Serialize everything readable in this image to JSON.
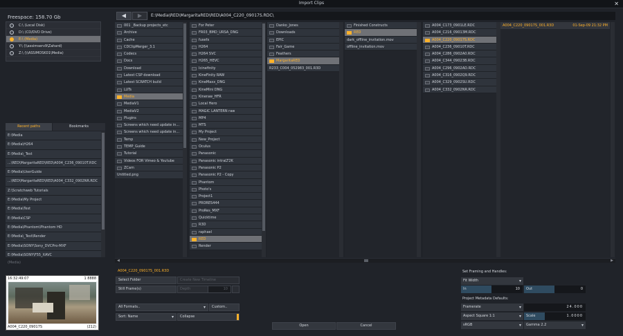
{
  "window": {
    "title": "Import Clips",
    "close_glyph": "✕"
  },
  "freespace": "Freespace: 158.70 Gb",
  "drives": [
    {
      "label": "C:\\ (Local Disk)",
      "selected": false
    },
    {
      "label": "D:\\ (CD/DVD Drive)",
      "selected": false
    },
    {
      "label": "E:\\ (Media)",
      "selected": true
    },
    {
      "label": "Y:\\ (\\\\assimserv9\\Zahard)",
      "selected": false
    },
    {
      "label": "Z:\\ (\\\\ASSIMOSK01\\Media)",
      "selected": false
    }
  ],
  "tabs": {
    "recent": "Recent paths",
    "bookmarks": "Bookmarks"
  },
  "recent_paths": [
    "E:\\Media",
    "E:\\Media\\H264",
    "E:\\Media\\_Test",
    "...\\RED\\MargaritaRED\\RED\\A004_C236_09010T.RDC",
    "E:\\Media\\UserGuide",
    "...\\RED\\MargaritaRED\\RED\\A004_C332_0902NR.RDC",
    "Z:\\Scratchweb Tutorials",
    "E:\\Media\\My Project",
    "E:\\Media\\Test",
    "E:\\Media\\CSP",
    "E:\\Media\\Phantom\\Phantom HD",
    "E:\\Media\\_Test\\Render",
    "E:\\Media\\SONY\\Sony_DVCPro-MXF",
    "E:\\Media\\SONY\\F55_XAVC"
  ],
  "media_label": "(Media)",
  "thumbnail": {
    "timecode": "16:32:49:07",
    "frames": "1 8888",
    "clip": "A004_C220_09017S",
    "count": "(212)"
  },
  "nav": {
    "back": "◀",
    "forward": "▶",
    "path": "E:\\Media\\RED\\MargaritaRED\\RED\\A004_C220_09017S.RDC\\"
  },
  "columns": [
    {
      "items": [
        {
          "label": "001 _Backup projects_etc",
          "type": "folder",
          "sel": false
        },
        {
          "label": "Archive",
          "type": "folder",
          "sel": false
        },
        {
          "label": "Cache",
          "type": "folder",
          "sel": false
        },
        {
          "label": "CDClipMerger_3.1",
          "type": "folder",
          "sel": false
        },
        {
          "label": "Codecs",
          "type": "folder",
          "sel": false
        },
        {
          "label": "Docs",
          "type": "folder",
          "sel": false
        },
        {
          "label": "Download",
          "type": "folder",
          "sel": false
        },
        {
          "label": "Latest CSP download",
          "type": "folder",
          "sel": false
        },
        {
          "label": "Latest SCRATCH build",
          "type": "folder",
          "sel": false
        },
        {
          "label": "LUTs",
          "type": "folder",
          "sel": false
        },
        {
          "label": "Media",
          "type": "folder",
          "sel": true
        },
        {
          "label": "MediaV1",
          "type": "folder",
          "sel": false
        },
        {
          "label": "MediaV2",
          "type": "folder",
          "sel": false
        },
        {
          "label": "Plugins",
          "type": "folder",
          "sel": false
        },
        {
          "label": "Screens which need update in...",
          "type": "folder",
          "sel": false
        },
        {
          "label": "Screens which need update in...",
          "type": "folder",
          "sel": false
        },
        {
          "label": "Temp",
          "type": "folder",
          "sel": false
        },
        {
          "label": "TEMP_Guide",
          "type": "folder",
          "sel": false
        },
        {
          "label": "Tutorial",
          "type": "folder",
          "sel": false
        },
        {
          "label": "Videos FOR Vimeo & Youtube",
          "type": "folder",
          "sel": false
        },
        {
          "label": "ZCam",
          "type": "folder",
          "sel": false
        },
        {
          "label": "Untitled.png",
          "type": "file",
          "sel": false
        }
      ]
    },
    {
      "items": [
        {
          "label": "For Peter",
          "type": "folder",
          "sel": false
        },
        {
          "label": "FR03_BMD_URSA_DNG",
          "type": "folder",
          "sel": false
        },
        {
          "label": "fusefx",
          "type": "folder",
          "sel": false
        },
        {
          "label": "H264",
          "type": "folder",
          "sel": false
        },
        {
          "label": "H264 SVC",
          "type": "folder",
          "sel": false
        },
        {
          "label": "H265_HEVC",
          "type": "folder",
          "sel": false
        },
        {
          "label": "Icinefinity",
          "type": "folder",
          "sel": false
        },
        {
          "label": "KineFinity RAW",
          "type": "folder",
          "sel": false
        },
        {
          "label": "KineMaxx_DNG",
          "type": "folder",
          "sel": false
        },
        {
          "label": "KineMini DNG",
          "type": "folder",
          "sel": false
        },
        {
          "label": "Kineraw_HFR",
          "type": "folder",
          "sel": false
        },
        {
          "label": "Local Hero",
          "type": "folder",
          "sel": false
        },
        {
          "label": "MAGIC LANTERN raw",
          "type": "folder",
          "sel": false
        },
        {
          "label": "MP4",
          "type": "folder",
          "sel": false
        },
        {
          "label": "MTS",
          "type": "folder",
          "sel": false
        },
        {
          "label": "My Project",
          "type": "folder",
          "sel": false
        },
        {
          "label": "New_Project",
          "type": "folder",
          "sel": false
        },
        {
          "label": "Oculus",
          "type": "folder",
          "sel": false
        },
        {
          "label": "Panasonic",
          "type": "folder",
          "sel": false
        },
        {
          "label": "Panasonic intraLT2K",
          "type": "folder",
          "sel": false
        },
        {
          "label": "Panasonic P2",
          "type": "folder",
          "sel": false
        },
        {
          "label": "Panasonic P2 - Copy",
          "type": "folder",
          "sel": false
        },
        {
          "label": "Phantom",
          "type": "folder",
          "sel": false
        },
        {
          "label": "Photo's",
          "type": "folder",
          "sel": false
        },
        {
          "label": "Project1",
          "type": "folder",
          "sel": false
        },
        {
          "label": "PRORES444",
          "type": "folder",
          "sel": false
        },
        {
          "label": "ProRes_MXF",
          "type": "folder",
          "sel": false
        },
        {
          "label": "Quicktime",
          "type": "folder",
          "sel": false
        },
        {
          "label": "R3D",
          "type": "folder",
          "sel": false
        },
        {
          "label": "raphael",
          "type": "folder",
          "sel": false
        },
        {
          "label": "RED",
          "type": "folder",
          "sel": true
        },
        {
          "label": "Render",
          "type": "folder",
          "sel": false
        }
      ]
    },
    {
      "items": [
        {
          "label": "Danko_Jones",
          "type": "folder",
          "sel": false
        },
        {
          "label": "Downloads",
          "type": "folder",
          "sel": false
        },
        {
          "label": "EPIC",
          "type": "folder",
          "sel": false
        },
        {
          "label": "Fair_Game",
          "type": "folder",
          "sel": false
        },
        {
          "label": "Feathers",
          "type": "folder",
          "sel": false
        },
        {
          "label": "MargaritaRED",
          "type": "folder",
          "sel": true
        },
        {
          "label": "R233_C004_052983_001.R3D",
          "type": "file",
          "sel": false
        }
      ]
    },
    {
      "items": [
        {
          "label": "Finished Constructs",
          "type": "folder",
          "sel": false
        },
        {
          "label": "RED",
          "type": "folder",
          "sel": true
        },
        {
          "label": "dark_offline_invitation.mov",
          "type": "file",
          "sel": false
        },
        {
          "label": "offline_invitation.mov",
          "type": "file",
          "sel": false
        }
      ]
    },
    {
      "items": [
        {
          "label": "A004_C173_0901LE.RDC",
          "type": "folder",
          "sel": false
        },
        {
          "label": "A004_C216_09013M.RDC",
          "type": "folder",
          "sel": false
        },
        {
          "label": "A004_C220_09017S.RDC",
          "type": "folder",
          "sel": true
        },
        {
          "label": "A004_C236_09010T.RDC",
          "type": "folder",
          "sel": false
        },
        {
          "label": "A004_C286_0902A0.RDC",
          "type": "folder",
          "sel": false
        },
        {
          "label": "A004_C344_09023B.RDC",
          "type": "folder",
          "sel": false
        },
        {
          "label": "A004_C296_0902AD.RDC",
          "type": "folder",
          "sel": false
        },
        {
          "label": "A004_C316_0902Q9.RDC",
          "type": "folder",
          "sel": false
        },
        {
          "label": "A004_C329_0902SU.RDC",
          "type": "folder",
          "sel": false
        },
        {
          "label": "A004_C332_0902NR.RDC",
          "type": "folder",
          "sel": false
        }
      ]
    }
  ],
  "file_column": {
    "name": "A004_C220_09017S_001.R3D",
    "date": "01-Sep-09 21:32 PM"
  },
  "selected_file": "A004_C220_09017S_001.R3D",
  "controls": {
    "select_folder": "Select Folder",
    "create_timeline": "Create New Timeline",
    "still_frames": "Still Frame(s)",
    "depth_label": "Depth",
    "depth_value": "10",
    "formats": "All Formats..",
    "custom": "Custom..",
    "sort": "Sort: Name",
    "collapse": "Collapse",
    "open": "Open",
    "cancel": "Cancel"
  },
  "framing": {
    "title": "Set Framing and Handles:",
    "mode": "Fit Width",
    "in_label": "In",
    "in_value": "10",
    "out_label": "Out",
    "out_value": "0",
    "meta_title": "Project Metadata Defaults:",
    "framerate_label": "Framerate",
    "framerate_value": "24.000",
    "aspect_label": "Aspect Square 1:1",
    "scale_label": "Scale",
    "scale_value": "1.0000",
    "colorspace": "sRGB",
    "gamma": "Gamma 2.2"
  }
}
